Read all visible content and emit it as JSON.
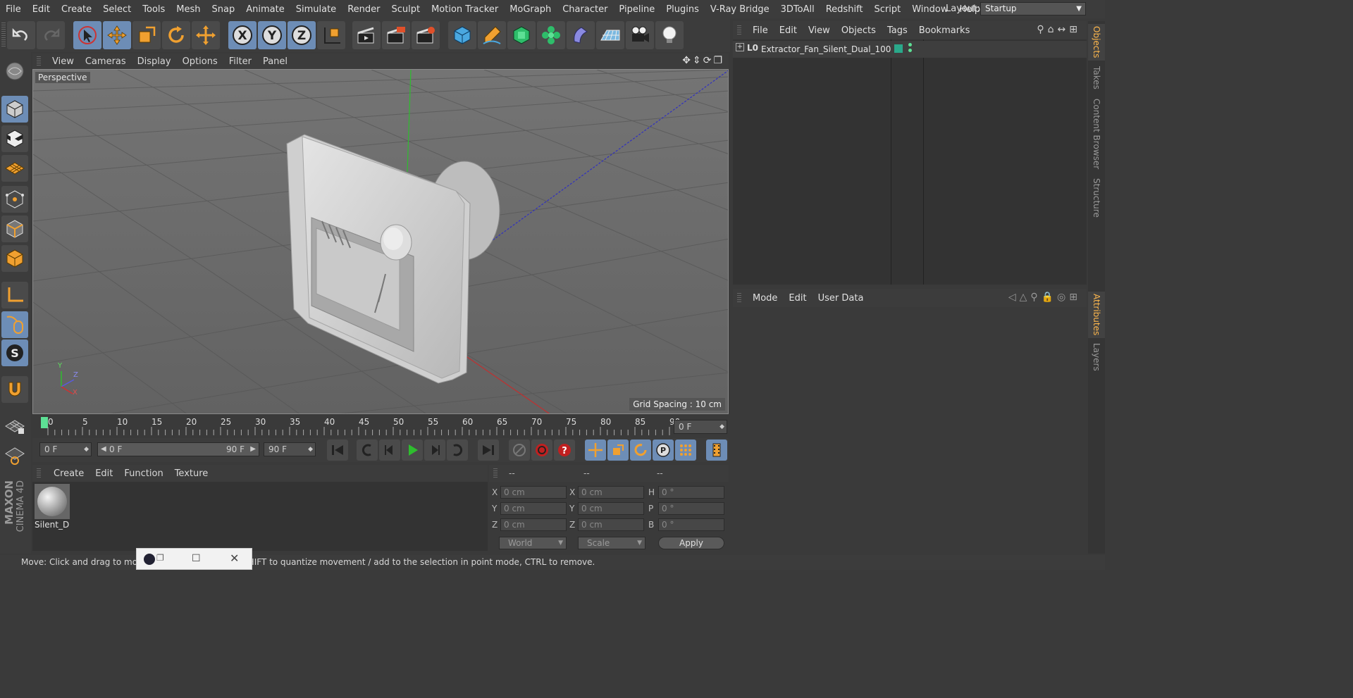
{
  "main_menu": [
    "File",
    "Edit",
    "Create",
    "Select",
    "Tools",
    "Mesh",
    "Snap",
    "Animate",
    "Simulate",
    "Render",
    "Sculpt",
    "Motion Tracker",
    "MoGraph",
    "Character",
    "Pipeline",
    "Plugins",
    "V-Ray Bridge",
    "3DToAll",
    "Redshift",
    "Script",
    "Window",
    "Help"
  ],
  "layout": {
    "label": "Layout:",
    "value": "Startup"
  },
  "viewport": {
    "menu": [
      "View",
      "Cameras",
      "Display",
      "Options",
      "Filter",
      "Panel"
    ],
    "camera_label": "Perspective",
    "grid_spacing": "Grid Spacing : 10 cm",
    "axis_labels": {
      "x": "X",
      "y": "Y",
      "z": "Z"
    }
  },
  "timeline": {
    "ticks": [
      "0",
      "5",
      "10",
      "15",
      "20",
      "25",
      "30",
      "35",
      "40",
      "45",
      "50",
      "55",
      "60",
      "65",
      "70",
      "75",
      "80",
      "85",
      "90"
    ],
    "current_frame": "0 F"
  },
  "transport": {
    "start_field": "0 F",
    "range_start": "0 F",
    "range_end": "90 F",
    "end_field": "90 F"
  },
  "material_manager": {
    "menu": [
      "Create",
      "Edit",
      "Function",
      "Texture"
    ],
    "material_name": "Silent_D"
  },
  "coordinates": {
    "headers": [
      "--",
      "--",
      "--"
    ],
    "rows": [
      {
        "l1": "X",
        "v1": "0 cm",
        "l2": "X",
        "v2": "0 cm",
        "l3": "H",
        "v3": "0 °"
      },
      {
        "l1": "Y",
        "v1": "0 cm",
        "l2": "Y",
        "v2": "0 cm",
        "l3": "P",
        "v3": "0 °"
      },
      {
        "l1": "Z",
        "v1": "0 cm",
        "l2": "Z",
        "v2": "0 cm",
        "l3": "B",
        "v3": "0 °"
      }
    ],
    "mode_world": "World",
    "mode_scale": "Scale",
    "apply_label": "Apply"
  },
  "object_manager": {
    "menu": [
      "File",
      "Edit",
      "View",
      "Objects",
      "Tags",
      "Bookmarks"
    ],
    "object_name": "Extractor_Fan_Silent_Dual_100"
  },
  "attribute_manager": {
    "menu": [
      "Mode",
      "Edit",
      "User Data"
    ]
  },
  "side_tabs": [
    "Objects",
    "Takes",
    "Content Browser",
    "Structure",
    "Attributes",
    "Layers"
  ],
  "status_text": "Move: Click and drag to move elements. Hold down SHIFT to quantize movement / add to the selection in point mode, CTRL to remove.",
  "brand": {
    "line1": "MAXON",
    "line2": "CINEMA 4D"
  },
  "colors": {
    "accent_blue": "#6d8db6",
    "orange": "#f0a030",
    "viewport_bg": "#6b6b6b",
    "active_tab": "#ffb84d"
  }
}
